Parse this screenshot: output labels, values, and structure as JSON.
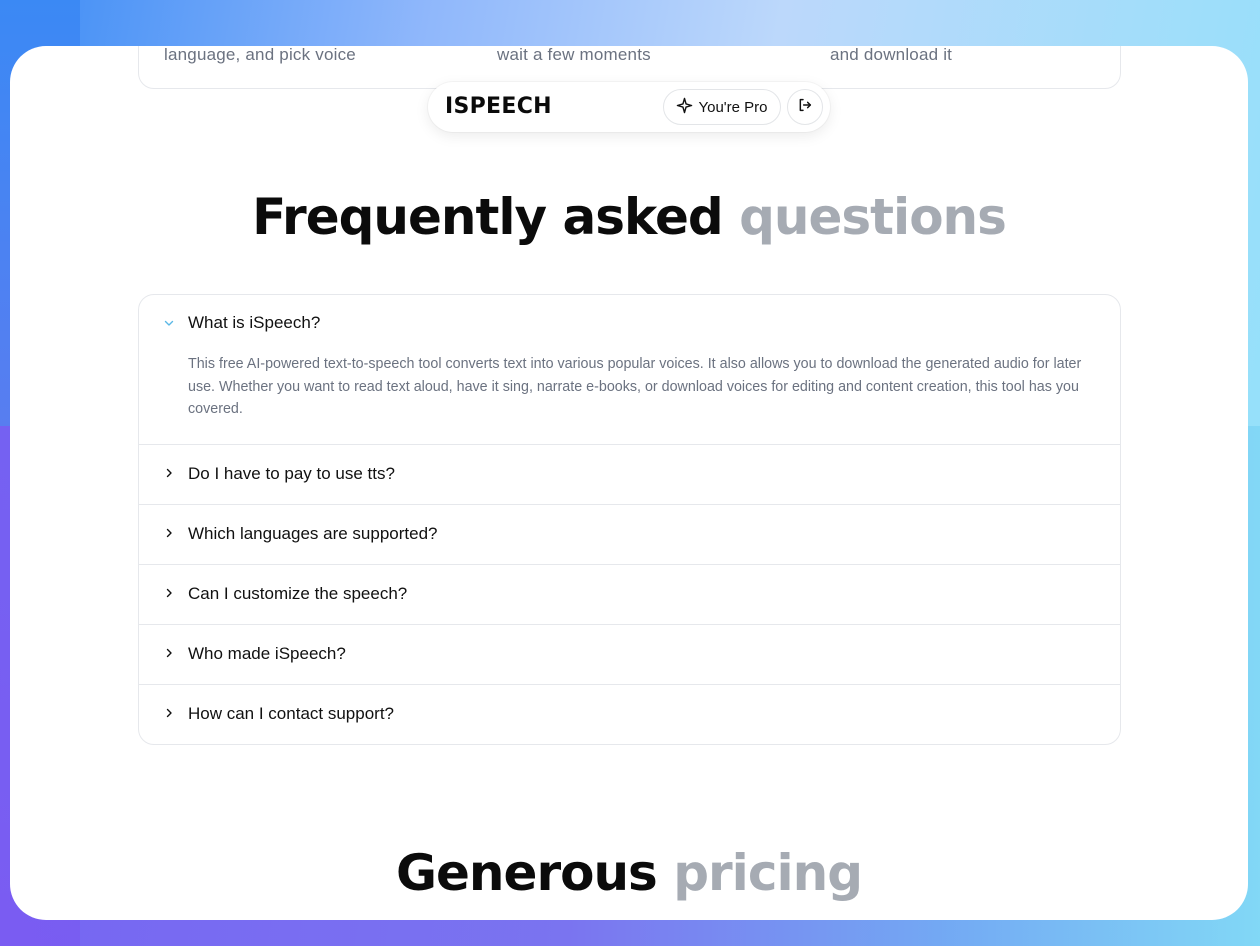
{
  "steps": {
    "items": [
      "language, and pick voice",
      "wait a few moments",
      "and download it"
    ]
  },
  "nav": {
    "logo": "ISPEECH",
    "pro_label": "You're Pro",
    "pro_icon": "sparkle-icon",
    "logout_icon": "logout-icon"
  },
  "faq": {
    "title_main": "Frequently asked",
    "title_muted": "questions",
    "items": [
      {
        "question": "What is iSpeech?",
        "answer": "This free AI-powered text-to-speech tool converts text into various popular voices. It also allows you to download the generated audio for later use. Whether you want to read text aloud, have it sing, narrate e-books, or download voices for editing and content creation, this tool has you covered.",
        "open": true
      },
      {
        "question": "Do I have to pay to use tts?",
        "open": false
      },
      {
        "question": "Which languages are supported?",
        "open": false
      },
      {
        "question": "Can I customize the speech?",
        "open": false
      },
      {
        "question": "Who made iSpeech?",
        "open": false
      },
      {
        "question": "How can I contact support?",
        "open": false
      }
    ]
  },
  "pricing": {
    "title_main": "Generous",
    "title_muted": "pricing"
  },
  "colors": {
    "accent_chevron": "#5bb8e6",
    "muted_heading": "#a6abb3"
  }
}
